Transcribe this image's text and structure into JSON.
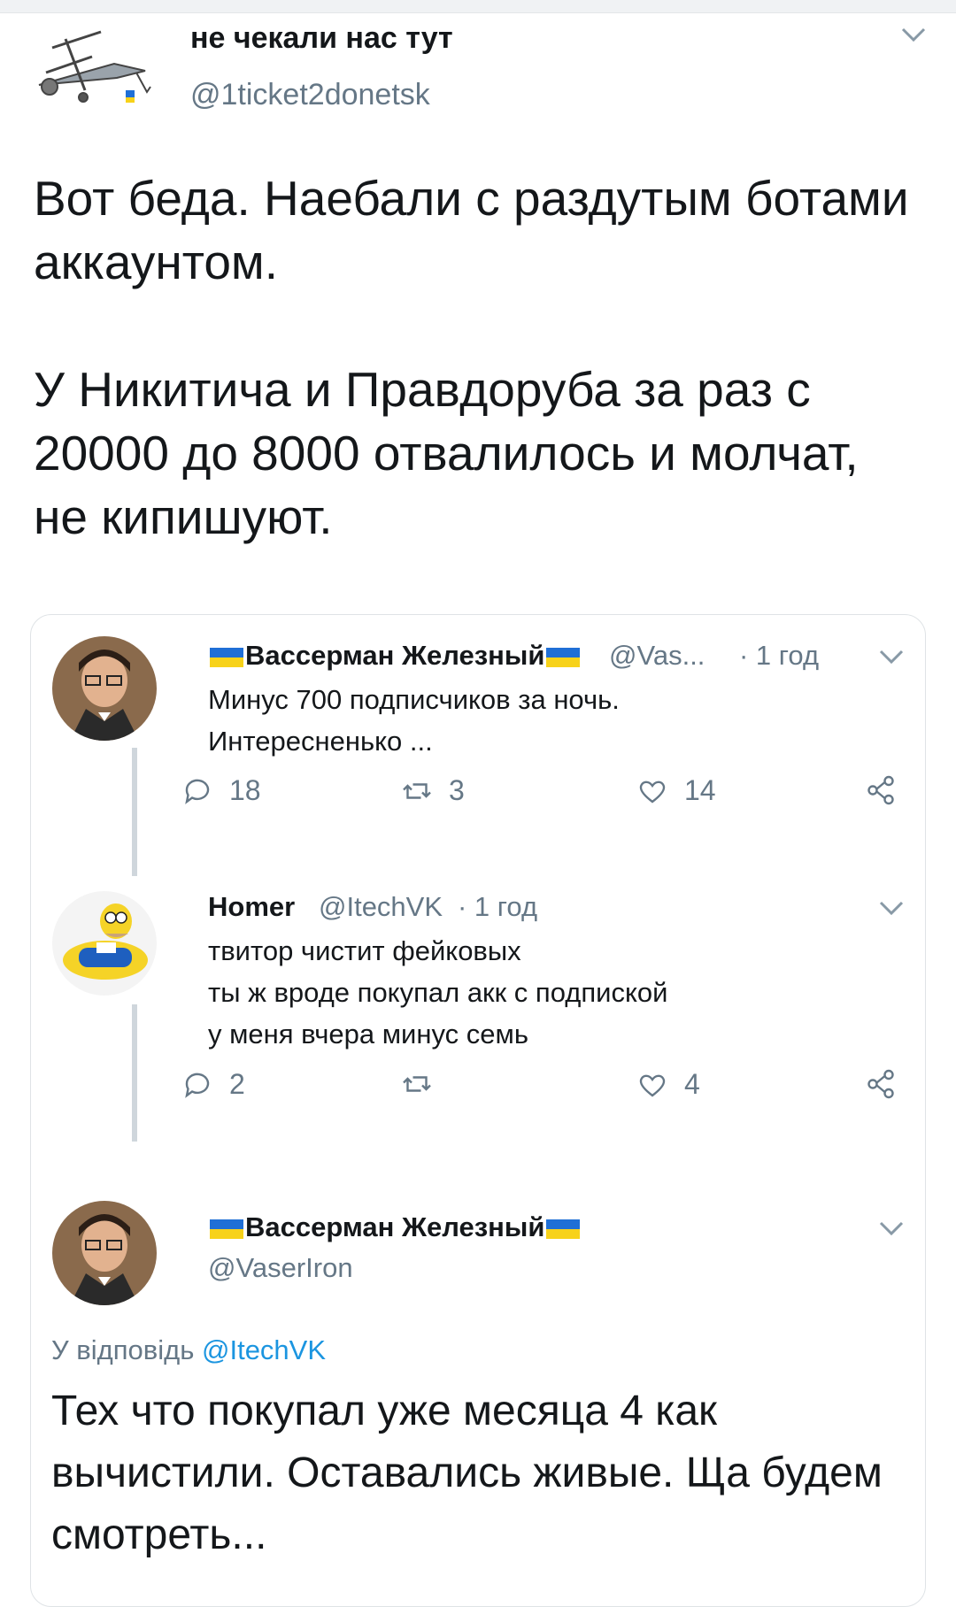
{
  "main_tweet": {
    "display_name": "не чекали нас тут",
    "handle": "@1ticket2donetsk",
    "text_lines": [
      "Вот беда. Наебали с раздутым ботами аккаунтом.",
      "У Никитича и Правдоруба за раз с 20000 до 8000 отвалилось и молчат, не кипишуют."
    ]
  },
  "thread": {
    "replies": [
      {
        "display_name": "Вассерман Железный",
        "handle": "@Vas...",
        "time": "· 1 год",
        "text": [
          "Минус 700 подписчиков за ночь.",
          "Интересненько ..."
        ],
        "reply_count": "18",
        "retweet_count": "3",
        "like_count": "14"
      },
      {
        "display_name": "Homer",
        "handle": "@ItechVK",
        "time": "· 1 год",
        "text": [
          "твитор чистит фейковых",
          "ты ж вроде покупал акк с подпиской",
          "у меня вчера минус семь"
        ],
        "reply_count": "2",
        "retweet_count": "",
        "like_count": "4"
      }
    ],
    "focused": {
      "display_name": "Вассерман Железный",
      "handle": "@VaserIron",
      "reply_to_label": "У відповідь",
      "reply_to_handle": "@ItechVK",
      "text": "Тех что покупал уже месяца 4 как вычистили. Оставались живые. Ща будем смотреть..."
    }
  },
  "icons": {
    "flag": "ukraine-flag-icon",
    "reply": "reply-icon",
    "retweet": "retweet-icon",
    "like": "heart-icon",
    "share": "share-icon",
    "caret": "chevron-down-icon"
  },
  "colors": {
    "text": "#14171a",
    "muted": "#657786",
    "link": "#1b95e0",
    "flag_blue": "#1f6fd6",
    "flag_yellow": "#f7d21a"
  }
}
